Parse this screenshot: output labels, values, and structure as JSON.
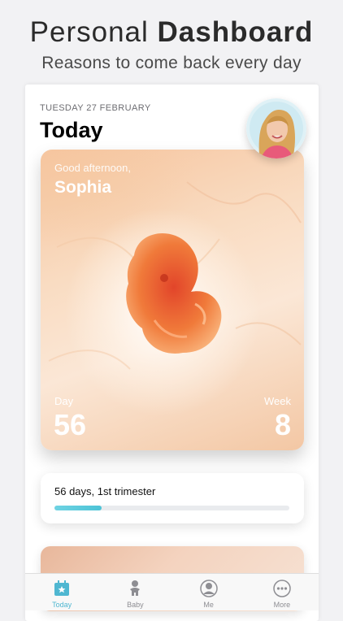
{
  "promo": {
    "title_light": "Personal",
    "title_bold": "Dashboard",
    "subtitle": "Reasons to come back every day"
  },
  "header": {
    "date": "TUESDAY 27 FEBRUARY",
    "title": "Today"
  },
  "hero": {
    "greeting": "Good afternoon,",
    "name": "Sophia",
    "day_label": "Day",
    "day_value": "56",
    "week_label": "Week",
    "week_value": "8"
  },
  "progress": {
    "text": "56 days, 1st trimester",
    "fraction": 0.2
  },
  "tabs": [
    {
      "label": "Today",
      "icon": "calendar-star-icon",
      "active": true
    },
    {
      "label": "Baby",
      "icon": "baby-icon",
      "active": false
    },
    {
      "label": "Me",
      "icon": "person-icon",
      "active": false
    },
    {
      "label": "More",
      "icon": "more-dots-icon",
      "active": false
    }
  ],
  "colors": {
    "accent": "#4fb7d1",
    "progress_fill": "#5ccbdc",
    "tab_inactive": "#8e8e93"
  }
}
